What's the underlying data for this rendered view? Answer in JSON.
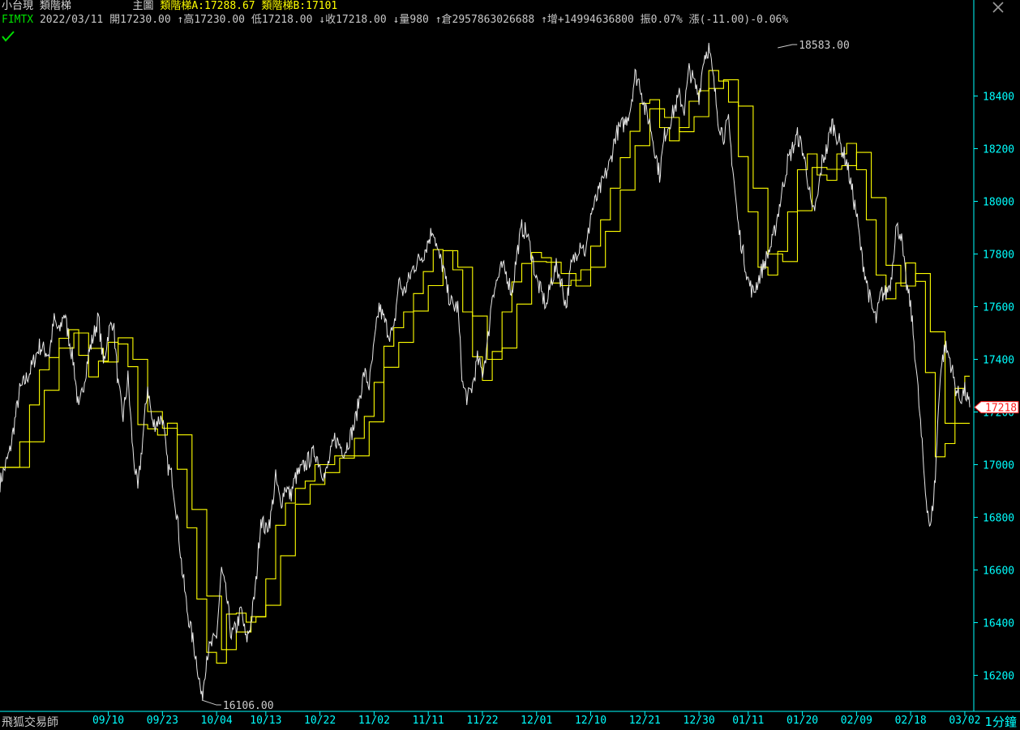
{
  "header": {
    "product": "小台現",
    "indicator_name": "類階梯",
    "pane_label": "主圖",
    "ladder_a": "類階梯A:17288.67",
    "ladder_b": "類階梯B:17101",
    "symbol": "FIMTX",
    "date": "2022/03/11",
    "open": "開17230.00",
    "high": "↑高17230.00",
    "low": "低17218.00",
    "close": "↓收17218.00",
    "volume": "↓量980",
    "open_interest": "↑倉2957863026688",
    "oi_change": "↑增+14994636800",
    "amplitude": "振0.07%",
    "change": "漲(-11.00)-0.06%"
  },
  "footer": {
    "brand": "飛狐交易師",
    "period": "1分鐘"
  },
  "colors": {
    "background": "#000000",
    "price": "#e8e8e8",
    "ladder": "#ffff00",
    "axis": "#00ffff",
    "last_price": "#ff2020"
  },
  "chart_data": {
    "type": "line",
    "ylim": [
      16100,
      18660
    ],
    "y_ticks": [
      16200,
      16400,
      16600,
      16800,
      17000,
      17200,
      17400,
      17600,
      17800,
      18000,
      18200,
      18400
    ],
    "x_ticks": [
      "09/10",
      "09/23",
      "10/04",
      "10/13",
      "10/22",
      "11/02",
      "11/11",
      "11/22",
      "12/01",
      "12/10",
      "12/21",
      "12/30",
      "01/11",
      "01/20",
      "02/09",
      "02/18",
      "03/02"
    ],
    "x_tick_index": [
      22,
      33,
      44,
      54,
      65,
      76,
      87,
      98,
      109,
      120,
      131,
      142,
      152,
      163,
      174,
      185,
      196
    ],
    "annotations": [
      {
        "label": "18583.00",
        "index": 158,
        "value": 18583
      },
      {
        "label": "16106.00",
        "index": 41,
        "value": 16106
      }
    ],
    "last_price": {
      "label": "17218",
      "value": 17218
    },
    "price_anchors": [
      [
        0,
        16930
      ],
      [
        2,
        17050
      ],
      [
        4,
        17280
      ],
      [
        6,
        17350
      ],
      [
        8,
        17450
      ],
      [
        10,
        17420
      ],
      [
        11,
        17550
      ],
      [
        12,
        17500
      ],
      [
        13,
        17580
      ],
      [
        15,
        17380
      ],
      [
        16,
        17200
      ],
      [
        18,
        17420
      ],
      [
        20,
        17560
      ],
      [
        21,
        17380
      ],
      [
        22,
        17500
      ],
      [
        23,
        17550
      ],
      [
        24,
        17300
      ],
      [
        25,
        17180
      ],
      [
        26,
        17330
      ],
      [
        27,
        17050
      ],
      [
        28,
        16900
      ],
      [
        29,
        17100
      ],
      [
        30,
        17300
      ],
      [
        31,
        17150
      ],
      [
        33,
        17180
      ],
      [
        34,
        17000
      ],
      [
        35,
        16950
      ],
      [
        36,
        16800
      ],
      [
        37,
        16600
      ],
      [
        38,
        16450
      ],
      [
        39,
        16350
      ],
      [
        40,
        16250
      ],
      [
        41,
        16106
      ],
      [
        42,
        16280
      ],
      [
        44,
        16350
      ],
      [
        45,
        16600
      ],
      [
        46,
        16500
      ],
      [
        47,
        16350
      ],
      [
        48,
        16380
      ],
      [
        49,
        16450
      ],
      [
        50,
        16330
      ],
      [
        51,
        16400
      ],
      [
        52,
        16550
      ],
      [
        53,
        16800
      ],
      [
        54,
        16750
      ],
      [
        55,
        16800
      ],
      [
        56,
        16950
      ],
      [
        57,
        16850
      ],
      [
        58,
        16920
      ],
      [
        59,
        16880
      ],
      [
        60,
        16950
      ],
      [
        62,
        17000
      ],
      [
        64,
        17050
      ],
      [
        66,
        16950
      ],
      [
        68,
        17100
      ],
      [
        70,
        17050
      ],
      [
        72,
        17150
      ],
      [
        74,
        17350
      ],
      [
        75,
        17300
      ],
      [
        76,
        17450
      ],
      [
        77,
        17600
      ],
      [
        78,
        17550
      ],
      [
        79,
        17500
      ],
      [
        80,
        17500
      ],
      [
        81,
        17700
      ],
      [
        82,
        17650
      ],
      [
        84,
        17750
      ],
      [
        86,
        17800
      ],
      [
        88,
        17900
      ],
      [
        89,
        17800
      ],
      [
        90,
        17750
      ],
      [
        91,
        17650
      ],
      [
        92,
        17600
      ],
      [
        93,
        17600
      ],
      [
        94,
        17300
      ],
      [
        95,
        17250
      ],
      [
        96,
        17300
      ],
      [
        97,
        17400
      ],
      [
        98,
        17350
      ],
      [
        99,
        17450
      ],
      [
        100,
        17650
      ],
      [
        101,
        17700
      ],
      [
        102,
        17750
      ],
      [
        103,
        17720
      ],
      [
        104,
        17650
      ],
      [
        105,
        17800
      ],
      [
        106,
        17900
      ],
      [
        107,
        17880
      ],
      [
        108,
        17800
      ],
      [
        109,
        17700
      ],
      [
        110,
        17650
      ],
      [
        111,
        17600
      ],
      [
        112,
        17700
      ],
      [
        113,
        17750
      ],
      [
        114,
        17700
      ],
      [
        115,
        17600
      ],
      [
        116,
        17750
      ],
      [
        117,
        17800
      ],
      [
        118,
        17850
      ],
      [
        119,
        17800
      ],
      [
        120,
        17950
      ],
      [
        121,
        18000
      ],
      [
        122,
        18050
      ],
      [
        123,
        18100
      ],
      [
        124,
        18150
      ],
      [
        125,
        18250
      ],
      [
        126,
        18280
      ],
      [
        127,
        18300
      ],
      [
        128,
        18350
      ],
      [
        129,
        18480
      ],
      [
        130,
        18450
      ],
      [
        131,
        18350
      ],
      [
        132,
        18300
      ],
      [
        133,
        18200
      ],
      [
        134,
        18100
      ],
      [
        135,
        18250
      ],
      [
        136,
        18300
      ],
      [
        137,
        18350
      ],
      [
        138,
        18400
      ],
      [
        139,
        18350
      ],
      [
        140,
        18500
      ],
      [
        141,
        18450
      ],
      [
        142,
        18400
      ],
      [
        143,
        18550
      ],
      [
        144,
        18583
      ],
      [
        145,
        18450
      ],
      [
        146,
        18300
      ],
      [
        147,
        18250
      ],
      [
        148,
        18300
      ],
      [
        149,
        18100
      ],
      [
        150,
        17900
      ],
      [
        151,
        17800
      ],
      [
        152,
        17700
      ],
      [
        153,
        17650
      ],
      [
        154,
        17700
      ],
      [
        155,
        17750
      ],
      [
        156,
        17800
      ],
      [
        157,
        17850
      ],
      [
        158,
        17950
      ],
      [
        159,
        18050
      ],
      [
        160,
        18150
      ],
      [
        161,
        18200
      ],
      [
        162,
        18250
      ],
      [
        163,
        18200
      ],
      [
        164,
        18100
      ],
      [
        165,
        17950
      ],
      [
        166,
        18000
      ],
      [
        167,
        18150
      ],
      [
        168,
        18200
      ],
      [
        169,
        18300
      ],
      [
        170,
        18250
      ],
      [
        171,
        18200
      ],
      [
        172,
        18150
      ],
      [
        173,
        18050
      ],
      [
        174,
        17950
      ],
      [
        175,
        17800
      ],
      [
        176,
        17700
      ],
      [
        177,
        17600
      ],
      [
        178,
        17550
      ],
      [
        179,
        17650
      ],
      [
        180,
        17650
      ],
      [
        181,
        17700
      ],
      [
        182,
        17900
      ],
      [
        183,
        17880
      ],
      [
        184,
        17700
      ],
      [
        185,
        17600
      ],
      [
        186,
        17400
      ],
      [
        187,
        17150
      ],
      [
        188,
        16900
      ],
      [
        189,
        16750
      ],
      [
        190,
        16950
      ],
      [
        191,
        17350
      ],
      [
        192,
        17450
      ],
      [
        193,
        17400
      ],
      [
        194,
        17300
      ],
      [
        195,
        17250
      ],
      [
        196,
        17280
      ],
      [
        197,
        17218
      ]
    ]
  }
}
